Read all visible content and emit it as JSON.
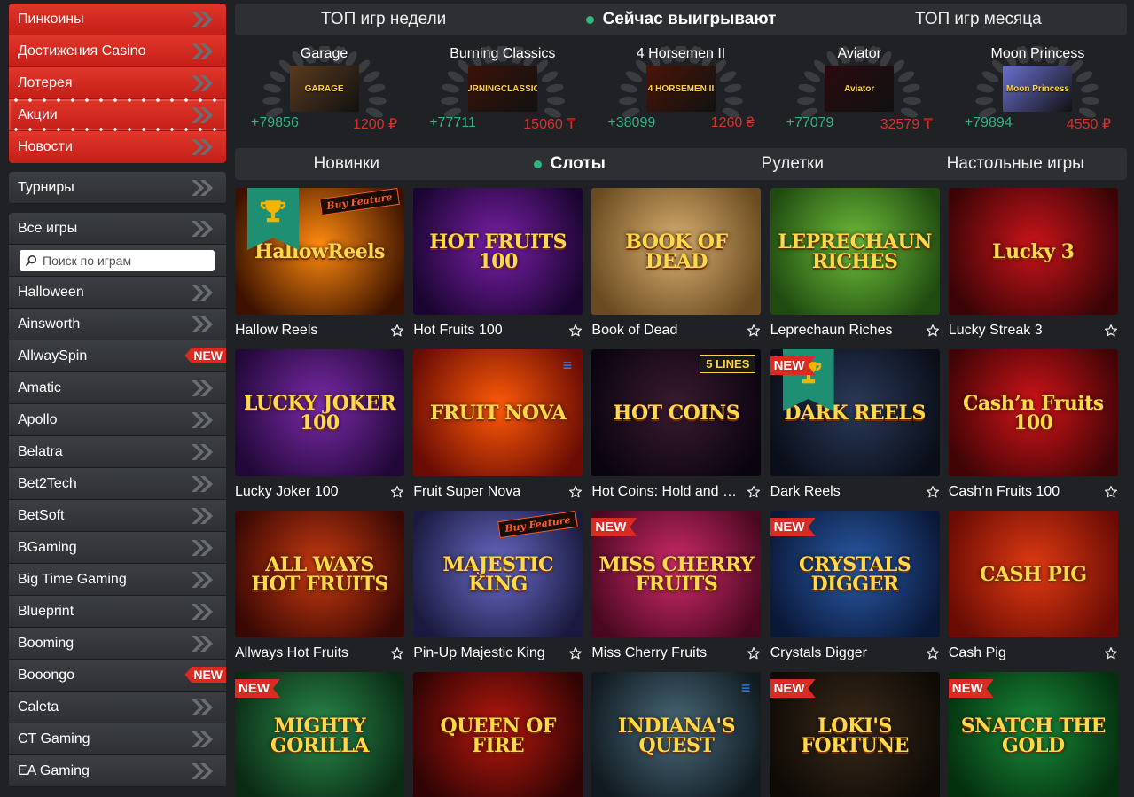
{
  "sidebar": {
    "promo_items": [
      {
        "label": "Пинкоины"
      },
      {
        "label": "Достижения Casino"
      },
      {
        "label": "Лотерея"
      },
      {
        "label": "Акции"
      },
      {
        "label": "Новости"
      }
    ],
    "tournaments_label": "Турниры",
    "all_games_label": "Все игры",
    "search_placeholder": "Поиск по играм",
    "providers": [
      {
        "label": "Halloween",
        "badge": ""
      },
      {
        "label": "Ainsworth",
        "badge": ""
      },
      {
        "label": "AllwaySpin",
        "badge": "NEW"
      },
      {
        "label": "Amatic",
        "badge": ""
      },
      {
        "label": "Apollo",
        "badge": ""
      },
      {
        "label": "Belatra",
        "badge": ""
      },
      {
        "label": "Bet2Tech",
        "badge": ""
      },
      {
        "label": "BetSoft",
        "badge": ""
      },
      {
        "label": "BGaming",
        "badge": ""
      },
      {
        "label": "Big Time Gaming",
        "badge": ""
      },
      {
        "label": "Blueprint",
        "badge": ""
      },
      {
        "label": "Booming",
        "badge": ""
      },
      {
        "label": "Booongo",
        "badge": "NEW"
      },
      {
        "label": "Caleta",
        "badge": ""
      },
      {
        "label": "CT Gaming",
        "badge": ""
      },
      {
        "label": "EA Gaming",
        "badge": ""
      }
    ]
  },
  "top_tabs": [
    {
      "label": "ТОП игр недели",
      "active": false
    },
    {
      "label": "Сейчас выигрывают",
      "active": true
    },
    {
      "label": "ТОП игр месяца",
      "active": false
    }
  ],
  "winners": [
    {
      "game": "Garage",
      "thumb_text": "GARAGE",
      "count": "+79856",
      "amount": "1200 ₽",
      "color": "#5a3a1e"
    },
    {
      "game": "Burning Classics",
      "thumb_text": "BURNINGCLASSICS",
      "count": "+77711",
      "amount": "15060 ₸",
      "color": "#3a1208"
    },
    {
      "game": "4 Horsemen II",
      "thumb_text": "4 HORSEMEN II",
      "count": "+38099",
      "amount": "1260 ₴",
      "color": "#4a1408"
    },
    {
      "game": "Aviator",
      "thumb_text": "Aviator",
      "count": "+77079",
      "amount": "32579 ₸",
      "color": "#2a0a0e"
    },
    {
      "game": "Moon Princess",
      "thumb_text": "Moon Princess",
      "count": "+79894",
      "amount": "4550 ₽",
      "color": "#6a6fd0"
    }
  ],
  "category_tabs": [
    {
      "label": "Новинки",
      "active": false
    },
    {
      "label": "Слоты",
      "active": true
    },
    {
      "label": "Рулетки",
      "active": false
    },
    {
      "label": "Настольные игры",
      "active": false
    }
  ],
  "games": [
    {
      "name": "Hallow Reels",
      "title": "HallowReels",
      "bg": "#ff8a10",
      "bg2": "#3b1200",
      "tag": "cup",
      "corner": "Buy Feature",
      "corner_type": "buy"
    },
    {
      "name": "Hot Fruits 100",
      "title": "HOT FRUITS 100",
      "bg": "#7a1fa8",
      "bg2": "#1a0530",
      "tag": "",
      "corner": "",
      "corner_type": ""
    },
    {
      "name": "Book of Dead",
      "title": "BOOK OF DEAD",
      "bg": "#d8b070",
      "bg2": "#6a4a20",
      "tag": "",
      "corner": "",
      "corner_type": ""
    },
    {
      "name": "Leprechaun Riches",
      "title": "LEPRECHAUN RICHES",
      "bg": "#6fbf3a",
      "bg2": "#1f4a10",
      "tag": "",
      "corner": "",
      "corner_type": ""
    },
    {
      "name": "Lucky Streak 3",
      "title": "Lucky 3",
      "bg": "#c8141a",
      "bg2": "#3a0406",
      "tag": "",
      "corner": "",
      "corner_type": ""
    },
    {
      "name": "Lucky Joker 100",
      "title": "LUCKY JOKER 100",
      "bg": "#7a2aa8",
      "bg2": "#220838",
      "tag": "",
      "corner": "",
      "corner_type": ""
    },
    {
      "name": "Fruit Super Nova",
      "title": "FRUIT NOVA",
      "bg": "#ff5a08",
      "bg2": "#6a0c04",
      "tag": "",
      "corner": "E",
      "corner_type": "e"
    },
    {
      "name": "Hot Coins: Hold and W...",
      "title": "HOT COINS",
      "bg": "#3a1a30",
      "bg2": "#0a0410",
      "tag": "",
      "corner": "5 LINES",
      "corner_type": "lines"
    },
    {
      "name": "Dark Reels",
      "title": "DARK REELS",
      "bg": "#2a3a5a",
      "bg2": "#0a0e18",
      "tag": "new-cup",
      "corner": "",
      "corner_type": ""
    },
    {
      "name": "Cash’n Fruits 100",
      "title": "Cash’n Fruits 100",
      "bg": "#d01418",
      "bg2": "#400406",
      "tag": "",
      "corner": "",
      "corner_type": ""
    },
    {
      "name": "Allways Hot Fruits",
      "title": "ALL WAYS HOT FRUITS",
      "bg": "#c83a10",
      "bg2": "#3a0804",
      "tag": "",
      "corner": "",
      "corner_type": ""
    },
    {
      "name": "Pin-Up Majestic King",
      "title": "MAJESTIC KING",
      "bg": "#6a6ac8",
      "bg2": "#1a1a40",
      "tag": "",
      "corner": "Buy Feature",
      "corner_type": "buy"
    },
    {
      "name": "Miss Cherry Fruits",
      "title": "MISS CHERRY FRUITS",
      "bg": "#d02a6a",
      "bg2": "#4a0820",
      "tag": "new",
      "corner": "",
      "corner_type": ""
    },
    {
      "name": "Crystals Digger",
      "title": "CRYSTALS DIGGER",
      "bg": "#2a5aa8",
      "bg2": "#0a1838",
      "tag": "new",
      "corner": "",
      "corner_type": ""
    },
    {
      "name": "Cash Pig",
      "title": "CASH PIG",
      "bg": "#e03a12",
      "bg2": "#6a0c04",
      "tag": "",
      "corner": "",
      "corner_type": ""
    },
    {
      "name": "Mighty Gorilla",
      "title": "MIGHTY GORILLA",
      "bg": "#2a8a4a",
      "bg2": "#0a2a14",
      "tag": "new",
      "corner": "",
      "corner_type": ""
    },
    {
      "name": "Queen of Fire",
      "title": "QUEEN OF FIRE",
      "bg": "#b8180e",
      "bg2": "#300404",
      "tag": "",
      "corner": "",
      "corner_type": ""
    },
    {
      "name": "Indiana's Quest",
      "title": "INDIANA'S QUEST",
      "bg": "#4a6a7a",
      "bg2": "#101a20",
      "tag": "",
      "corner": "E",
      "corner_type": "e"
    },
    {
      "name": "Loki's Fortune",
      "title": "LOKI'S FORTUNE",
      "bg": "#3a2a1a",
      "bg2": "#0e0a06",
      "tag": "new",
      "corner": "",
      "corner_type": ""
    },
    {
      "name": "Snatch the Gold",
      "title": "SNATCH THE GOLD",
      "bg": "#1a8a3a",
      "bg2": "#04300e",
      "tag": "new",
      "corner": "",
      "corner_type": ""
    }
  ],
  "colors": {
    "accent_red": "#d7322b",
    "accent_green": "#2fb37f",
    "panel": "#2d2f33",
    "background": "#1f2124"
  },
  "icons": {
    "chevron": "double-chevron-right-icon",
    "search": "search-icon",
    "star": "star-outline-icon",
    "cup": "trophy-icon",
    "laurel": "laurel-wreath-icon"
  }
}
